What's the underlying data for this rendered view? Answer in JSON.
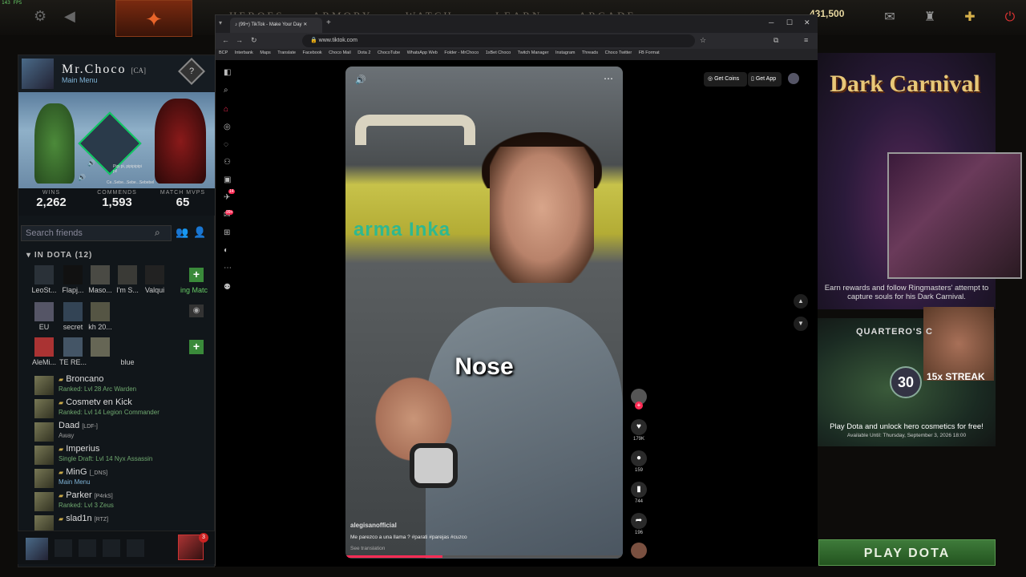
{
  "top": {
    "fps": "143 FPS",
    "nav": [
      "HEROES",
      "ARMORY",
      "WATCH",
      "LEARN",
      "ARCADE"
    ],
    "gold": "431,500"
  },
  "profile": {
    "name": "Mr.Choco",
    "tag": "[CA]",
    "status": "Main Menu",
    "speech1": "Pipi pi, pipipipipi pi!",
    "speech2": "Ce..Sebe...Sebe...Sebebel",
    "stats": [
      {
        "label": "WINS",
        "value": "2,262"
      },
      {
        "label": "COMMENDS",
        "value": "1,593"
      },
      {
        "label": "MATCH MVPS",
        "value": "65"
      }
    ]
  },
  "friends": {
    "search_placeholder": "Search friends",
    "section": "IN DOTA",
    "count": "(12)",
    "grid_row1": [
      "LeoSt...",
      "Flapj...",
      "Maso...",
      "I'm S...",
      "Valqui",
      "ing Matc"
    ],
    "grid_row2": [
      "EU",
      "secret",
      "kh 20..."
    ],
    "grid_row3": [
      "AleMi...",
      "TE RE...",
      "",
      "blue"
    ],
    "list": [
      {
        "name": "Broncano",
        "tag": "",
        "status": "Ranked: Lvl 28 Arc Warden",
        "cls": ""
      },
      {
        "name": "Cosmetv en Kick",
        "tag": "",
        "status": "Ranked: Lvl 14 Legion Commander",
        "cls": ""
      },
      {
        "name": "Daad",
        "tag": "[LDF-]",
        "status": "Away",
        "cls": "gray"
      },
      {
        "name": "Imperius",
        "tag": "",
        "status": "Single Draft: Lvl 14 Nyx Assassin",
        "cls": ""
      },
      {
        "name": "MinG",
        "tag": "[_DNS]",
        "status": "Main Menu",
        "cls": "blue"
      },
      {
        "name": "Parker",
        "tag": "[P4rkS]",
        "status": "Ranked: Lvl 3 Zeus",
        "cls": ""
      },
      {
        "name": "slad1n",
        "tag": "[RTZ]",
        "status": "",
        "cls": ""
      }
    ],
    "party_badge": "3"
  },
  "browser": {
    "tab_title": "(99+) TikTok - Make Your Day",
    "url": "www.tiktok.com",
    "bookmarks": [
      "BCP",
      "Interbank",
      "Maps",
      "Translate",
      "Facebook",
      "Choco Mail",
      "Dota 2",
      "ChocoTube",
      "WhatsApp Web",
      "Folder - MrChoco",
      "1xBet Choco",
      "Twitch Manager",
      "Instagram",
      "Threads",
      "Choco Twitter",
      "FB Format"
    ]
  },
  "tiktok": {
    "get_coins": "Get Coins",
    "get_app": "Get App",
    "caption": "Nose",
    "sign_text": "arma  Inka",
    "author": "alegisanofficial",
    "description": "Me parezco a una llama ? #parati #parejas #cuzco",
    "see_translation": "See translation",
    "likes": "179K",
    "comments": "159",
    "saves": "744",
    "shares": "196",
    "badge": "99+",
    "badge2": "14"
  },
  "promo": {
    "dark_carnival": "Dark Carnival",
    "dc_desc": "Earn rewards and follow Ringmasters' attempt to capture souls for his Dark Carnival.",
    "quartero_title": "QUARTERO'S C",
    "streak_num": "30",
    "streak_label": "15x STREAK",
    "q_desc": "Play Dota and unlock hero cosmetics for free!",
    "q_avail": "Available Until: Thursday, September 3, 2026 18:00",
    "play": "PLAY DOTA"
  }
}
